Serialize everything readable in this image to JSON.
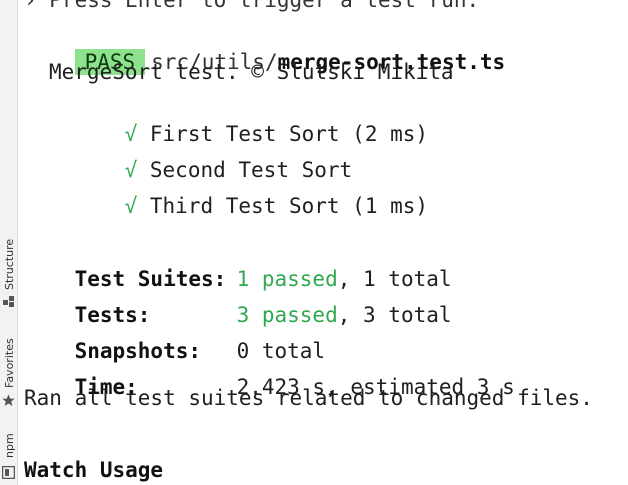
{
  "side_tabs": {
    "structure": "Structure",
    "favorites": "Favorites",
    "npm": "npm"
  },
  "terminal": {
    "top_hint": "› Press Enter to trigger a test run.",
    "result": {
      "status": "PASS",
      "path_dir": "src/utils/",
      "path_file": "merge-sort.test.ts"
    },
    "suite_title": "MergeSort test. © Slutski Mikita",
    "tests": [
      {
        "mark": "√",
        "label": "First Test Sort (2 ms)"
      },
      {
        "mark": "√",
        "label": "Second Test Sort"
      },
      {
        "mark": "√",
        "label": "Third Test Sort (1 ms)"
      }
    ],
    "summary": {
      "suites_label": "Test Suites:",
      "suites_passed": "1 passed",
      "suites_total": ", 1 total",
      "tests_label": "Tests:",
      "tests_passed": "3 passed",
      "tests_total": ", 3 total",
      "snapshots_label": "Snapshots:",
      "snapshots_value": "0 total",
      "time_label": "Time:",
      "time_value": "2.423 s, estimated 3 s",
      "ran_all": "Ran all test suites related to changed files."
    },
    "watch_usage": "Watch Usage"
  },
  "colors": {
    "pass_badge_bg": "#8ee28e",
    "passed_green": "#2fa84f"
  },
  "icons": [
    "structure-icon",
    "star-icon",
    "npm-icon"
  ]
}
